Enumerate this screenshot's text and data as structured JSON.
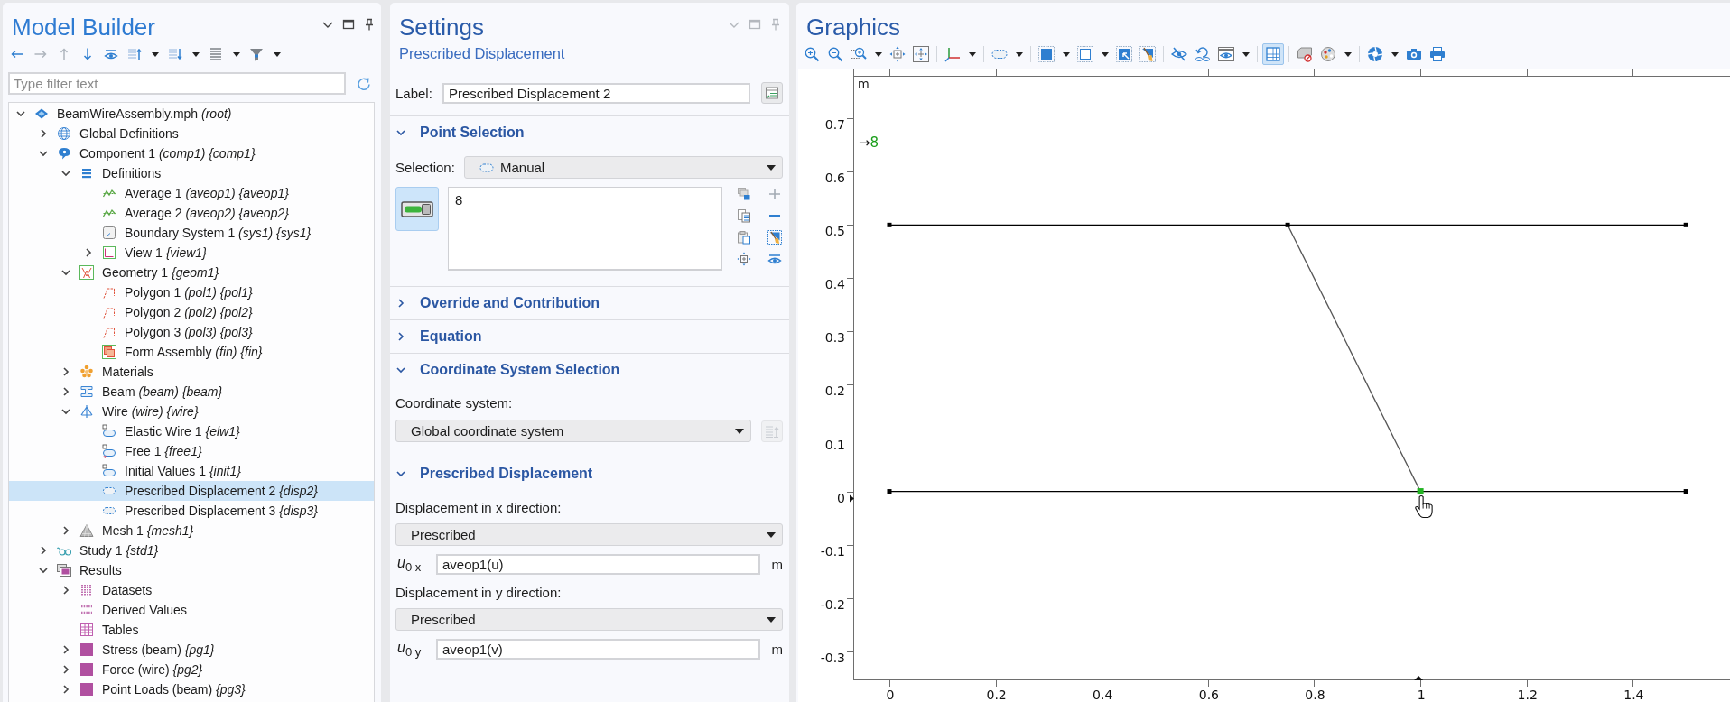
{
  "model_builder": {
    "title": "Model Builder",
    "toolbar": [
      {
        "kind": "back",
        "disabled": false
      },
      {
        "kind": "forward",
        "disabled": true
      },
      {
        "kind": "up",
        "disabled": true
      },
      {
        "kind": "down",
        "disabled": false
      },
      {
        "kind": "show",
        "disabled": false
      },
      {
        "kind": "collapse",
        "disabled": false,
        "menu": true
      },
      {
        "kind": "expand",
        "disabled": false,
        "menu": true
      },
      {
        "kind": "list",
        "disabled": false,
        "menu": true
      },
      {
        "kind": "filter",
        "disabled": false,
        "menu": true
      }
    ],
    "filter": {
      "placeholder": "Type filter text"
    },
    "tree": [
      {
        "label": "BeamWireAssembly.mph *(root)*",
        "kind": "model",
        "expanded": true,
        "selected": false,
        "children": [
          {
            "label": "Global Definitions",
            "kind": "globe",
            "expanded": false,
            "selected": false
          },
          {
            "label": "Component 1 *(comp1) {comp1}*",
            "kind": "component",
            "expanded": true,
            "selected": false,
            "children": [
              {
                "label": "Definitions",
                "kind": "definitions",
                "expanded": true,
                "selected": false,
                "children": [
                  {
                    "label": "Average 1 *(aveop1) {aveop1}*",
                    "kind": "average",
                    "selected": false
                  },
                  {
                    "label": "Average 2 *(aveop2) {aveop2}*",
                    "kind": "average",
                    "selected": false
                  },
                  {
                    "label": "Boundary System 1 *(sys1) {sys1}*",
                    "kind": "coordinates",
                    "selected": false
                  },
                  {
                    "label": "View 1 *{view1}*",
                    "kind": "view",
                    "expanded": false,
                    "selected": false
                  }
                ]
              },
              {
                "label": "Geometry 1 *{geom1}*",
                "kind": "geometry",
                "expanded": true,
                "selected": false,
                "children": [
                  {
                    "label": "Polygon 1 *(pol1) {pol1}*",
                    "kind": "polygon",
                    "selected": false
                  },
                  {
                    "label": "Polygon 2 *(pol2) {pol2}*",
                    "kind": "polygon",
                    "selected": false
                  },
                  {
                    "label": "Polygon 3 *(pol3) {pol3}*",
                    "kind": "polygon",
                    "selected": false
                  },
                  {
                    "label": "Form Assembly *(fin) {fin}*",
                    "kind": "assembly",
                    "selected": false
                  }
                ]
              },
              {
                "label": "Materials",
                "kind": "materials",
                "expanded": false,
                "selected": false
              },
              {
                "label": "Beam *(beam) {beam}*",
                "kind": "beam",
                "expanded": false,
                "selected": false
              },
              {
                "label": "Wire *(wire) {wire}*",
                "kind": "wire",
                "expanded": true,
                "selected": false,
                "children": [
                  {
                    "label": "Elastic Wire 1 *{elw1}*",
                    "kind": "wire-feature",
                    "selected": false
                  },
                  {
                    "label": "Free 1 *{free1}*",
                    "kind": "free",
                    "selected": false
                  },
                  {
                    "label": "Initial Values 1 *{init1}*",
                    "kind": "initial",
                    "selected": false
                  },
                  {
                    "label": "Prescribed Displacement 2 *{disp2}*",
                    "kind": "constraint",
                    "selected": true
                  },
                  {
                    "label": "Prescribed Displacement 3 *{disp3}*",
                    "kind": "constraint",
                    "selected": false
                  }
                ]
              },
              {
                "label": "Mesh 1 *{mesh1}*",
                "kind": "mesh",
                "expanded": false,
                "selected": false
              }
            ]
          },
          {
            "label": "Study 1 *{std1}*",
            "kind": "study",
            "expanded": false,
            "selected": false
          },
          {
            "label": "Results",
            "kind": "results",
            "expanded": true,
            "selected": false,
            "children": [
              {
                "label": "Datasets",
                "kind": "datasets",
                "expanded": false,
                "selected": false
              },
              {
                "label": "Derived Values",
                "kind": "derived",
                "selected": false
              },
              {
                "label": "Tables",
                "kind": "tables",
                "selected": false
              },
              {
                "label": "Stress (beam) *{pg1}*",
                "kind": "plot",
                "expanded": false,
                "selected": false
              },
              {
                "label": "Force (wire) *{pg2}*",
                "kind": "plot",
                "expanded": false,
                "selected": false
              },
              {
                "label": "Point Loads (beam) *{pg3}*",
                "kind": "plot",
                "expanded": false,
                "selected": false
              }
            ]
          }
        ]
      }
    ]
  },
  "settings": {
    "title": "Settings",
    "subtitle": "Prescribed Displacement",
    "label": {
      "caption": "Label:",
      "value": "Prescribed Displacement 2"
    },
    "sections": [
      {
        "kind": "selection",
        "title": "Point Selection",
        "expanded": true,
        "caption": "Selection:",
        "value": "Manual",
        "active": true,
        "items": [
          "8"
        ],
        "tools": [
          {
            "kind": "copy",
            "disabled": false
          },
          {
            "kind": "add",
            "disabled": true
          },
          {
            "kind": "paste-list",
            "disabled": false
          },
          {
            "kind": "remove",
            "disabled": false
          },
          {
            "kind": "paste",
            "disabled": false
          },
          {
            "kind": "clear",
            "disabled": false
          },
          {
            "kind": "zoom",
            "disabled": false
          },
          {
            "kind": "show",
            "disabled": false
          }
        ]
      },
      {
        "title": "Override and Contribution",
        "expanded": false
      },
      {
        "title": "Equation",
        "expanded": false
      },
      {
        "kind": "coordinates",
        "title": "Coordinate System Selection",
        "expanded": true,
        "caption": "Coordinate system:",
        "value": "Global coordinate system",
        "button_disabled": true
      },
      {
        "kind": "displacement",
        "title": "Prescribed Displacement",
        "expanded": true,
        "fields": [
          {
            "caption": "Displacement in x direction:",
            "choice": "Prescribed",
            "symbol": "*u*$_{0 x}$",
            "value": "aveop1(u)",
            "unit": "m"
          },
          {
            "caption": "Displacement in y direction:",
            "choice": "Prescribed",
            "symbol": "*u*$_{0 y}$",
            "value": "aveop1(v)",
            "unit": "m"
          }
        ]
      }
    ]
  },
  "graphics": {
    "title": "Graphics",
    "toolbar": [
      {
        "kind": "zoom-in"
      },
      {
        "kind": "zoom-out"
      },
      {
        "kind": "zoom-box",
        "menu": true
      },
      {
        "kind": "zoom-extents"
      },
      {
        "kind": "zoom-selected"
      },
      {
        "kind": "separator"
      },
      {
        "kind": "axes",
        "menu": true
      },
      {
        "kind": "separator"
      },
      {
        "kind": "select-points",
        "menu": true
      },
      {
        "kind": "separator"
      },
      {
        "kind": "select-objects",
        "menu": true
      },
      {
        "kind": "select-box",
        "menu": true
      },
      {
        "kind": "select-all"
      },
      {
        "kind": "clear"
      },
      {
        "kind": "separator"
      },
      {
        "kind": "hide"
      },
      {
        "kind": "reset-hiding"
      },
      {
        "kind": "views",
        "menu": true
      },
      {
        "kind": "separator"
      },
      {
        "kind": "grid",
        "on": true
      },
      {
        "kind": "separator"
      },
      {
        "kind": "transparency"
      },
      {
        "kind": "render",
        "menu": true
      },
      {
        "kind": "separator"
      },
      {
        "kind": "aperture",
        "menu": true
      },
      {
        "kind": "camera"
      },
      {
        "kind": "print"
      }
    ],
    "point_label": {
      "arrow": "→",
      "number": "8"
    },
    "chart_data": {
      "type": "line",
      "ylabel": "m",
      "xlim": [
        -0.068,
        1.583
      ],
      "ylim": [
        -0.353,
        0.78
      ],
      "xticks": [
        0,
        0.2,
        0.4,
        0.6,
        0.8,
        1,
        1.2,
        1.4
      ],
      "yticks": [
        -0.3,
        -0.2,
        -0.1,
        0,
        0.1,
        0.2,
        0.3,
        0.4,
        0.5,
        0.6,
        0.7
      ],
      "series": [
        {
          "color": "#000000",
          "marker": "square",
          "x": [
            0,
            0.75,
            1.5
          ],
          "values": [
            0.5,
            0.5,
            0.5
          ]
        },
        {
          "color": "#000000",
          "marker": "square",
          "x": [
            0,
            1,
            1.5
          ],
          "values": [
            0,
            0,
            0
          ]
        },
        {
          "color": "#555555",
          "x": [
            0.75,
            1
          ],
          "values": [
            0.5,
            0
          ]
        },
        {
          "color": "#22b422",
          "marker": "square",
          "x": [
            1
          ],
          "values": [
            0
          ]
        }
      ]
    }
  }
}
